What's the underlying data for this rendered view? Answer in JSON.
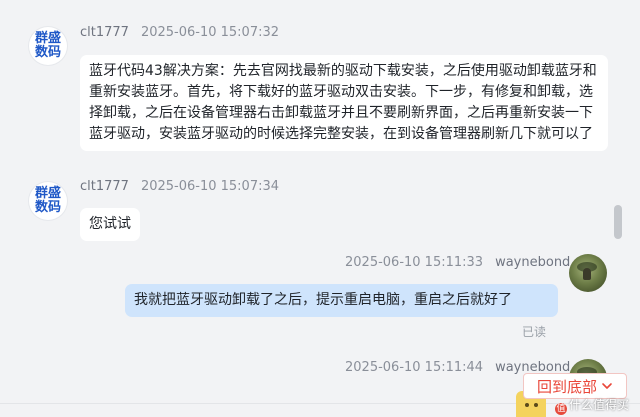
{
  "messages": [
    {
      "sender": "clt1777",
      "avatar_text": [
        "群盛",
        "数码"
      ],
      "timestamp": "2025-06-10 15:07:32",
      "text": "蓝牙代码43解决方案：先去官网找最新的驱动下载安装，之后使用驱动卸载蓝牙和重新安装蓝牙。首先，将下载好的蓝牙驱动双击安装。下一步，有修复和卸载，选择卸载，之后在设备管理器右击卸载蓝牙并且不要刷新界面，之后再重新安装一下蓝牙驱动，安装蓝牙驱动的时候选择完整安装，在到设备管理器刷新几下就可以了"
    },
    {
      "sender": "clt1777",
      "avatar_text": [
        "群盛",
        "数码"
      ],
      "timestamp": "2025-06-10 15:07:34",
      "text": "您试试"
    },
    {
      "sender": "waynebond",
      "timestamp": "2025-06-10 15:11:33",
      "text": "我就把蓝牙驱动卸载了之后，提示重启电脑，重启之后就好了",
      "status": "已读"
    },
    {
      "sender": "waynebond",
      "timestamp": "2025-06-10 15:11:44"
    }
  ],
  "back_to_bottom": {
    "label": "回到底部",
    "icon": "chevron-down-icon"
  },
  "watermark": {
    "logo": "值",
    "text": "什么值得买"
  },
  "colors": {
    "accent": "#e9473a",
    "avatar_text": "#1f58c7",
    "own_bubble": "#cfe4fc",
    "other_bubble": "#ffffff",
    "background": "#f2f3f5"
  }
}
